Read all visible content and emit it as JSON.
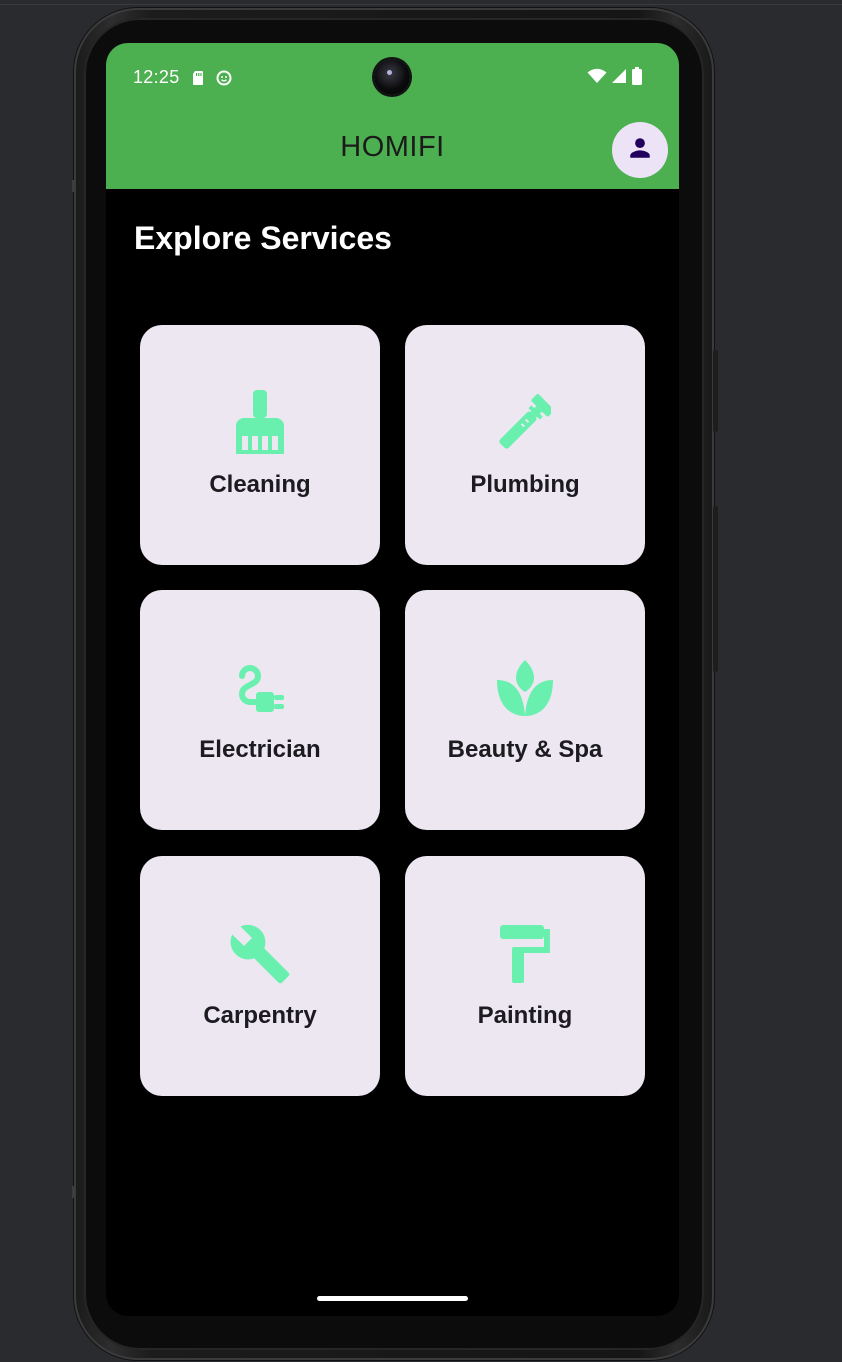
{
  "status_bar": {
    "time": "12:25",
    "left_icons": [
      "sd-card-icon",
      "face-icon"
    ],
    "right_icons": [
      "wifi-icon",
      "signal-icon",
      "battery-icon"
    ]
  },
  "app_bar": {
    "title": "HOMIFI",
    "background": "#4caf50",
    "profile_icon": "person-icon"
  },
  "main": {
    "section_title": "Explore Services",
    "accent_color": "#69f0ae",
    "card_color": "#ede7f2",
    "services": [
      {
        "label": "Cleaning",
        "icon": "broom-icon"
      },
      {
        "label": "Plumbing",
        "icon": "pipe-wrench-icon"
      },
      {
        "label": "Electrician",
        "icon": "power-plug-icon"
      },
      {
        "label": "Beauty & Spa",
        "icon": "spa-lotus-icon"
      },
      {
        "label": "Carpentry",
        "icon": "wrench-icon"
      },
      {
        "label": "Painting",
        "icon": "paint-roller-icon"
      }
    ]
  }
}
